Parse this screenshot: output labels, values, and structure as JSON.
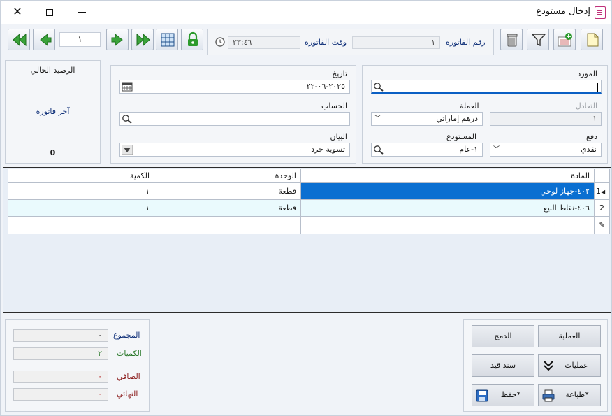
{
  "window": {
    "title": "إدخال مستودع"
  },
  "nav": {
    "page": "١"
  },
  "invoice": {
    "number_label": "رقم الفاتورة",
    "number_value": "١",
    "time_label": "وقت الفاتورة",
    "time_value": "٢٣:٤٦"
  },
  "balance": {
    "current_label": "الرصيد الحالي",
    "last_invoice_label": "آخر فاتورة",
    "value": "0"
  },
  "form": {
    "supplier_label": "المورد",
    "supplier_value": "",
    "exchange_label": "التعادل",
    "exchange_value": "١",
    "currency_label": "العملة",
    "currency_value": "درهم إماراتي",
    "payment_label": "دفع",
    "payment_value": "نقدي",
    "warehouse_label": "المستودع",
    "warehouse_value": "١-عام",
    "date_label": "تاريخ",
    "date_value": "٢٠٢٥-٠٦-٢٢",
    "account_label": "الحساب",
    "account_value": "",
    "statement_label": "البيان",
    "statement_value": "تسوية جرد"
  },
  "table": {
    "headers": {
      "item": "المادة",
      "unit": "الوحدة",
      "qty": "الكمية"
    },
    "rows": [
      {
        "num": "1",
        "item": "٤٠٢-جهاز لوحي",
        "unit": "قطعة",
        "qty": "١"
      },
      {
        "num": "2",
        "item": "٤٠٦-نقاط البيع",
        "unit": "قطعة",
        "qty": "١"
      },
      {
        "num": "",
        "item": "",
        "unit": "",
        "qty": ""
      }
    ]
  },
  "totals": {
    "total_label": "المجموع",
    "total_value": "٠",
    "quantities_label": "الكميات",
    "quantities_value": "٢",
    "net_label": "الصافي",
    "net_value": "٠",
    "final_label": "النهائي",
    "final_value": "٠"
  },
  "actions": {
    "operation": "العملية",
    "merge": "الدمج",
    "operations": "عمليات",
    "voucher": "سند قيد",
    "print": "طباعة*",
    "save": "حفظ*"
  },
  "colors": {
    "selected_row": "#0a6fd1",
    "accent_green": "#2c9a2c",
    "label_blue": "#12327a",
    "alt_row": "#eafafd"
  }
}
